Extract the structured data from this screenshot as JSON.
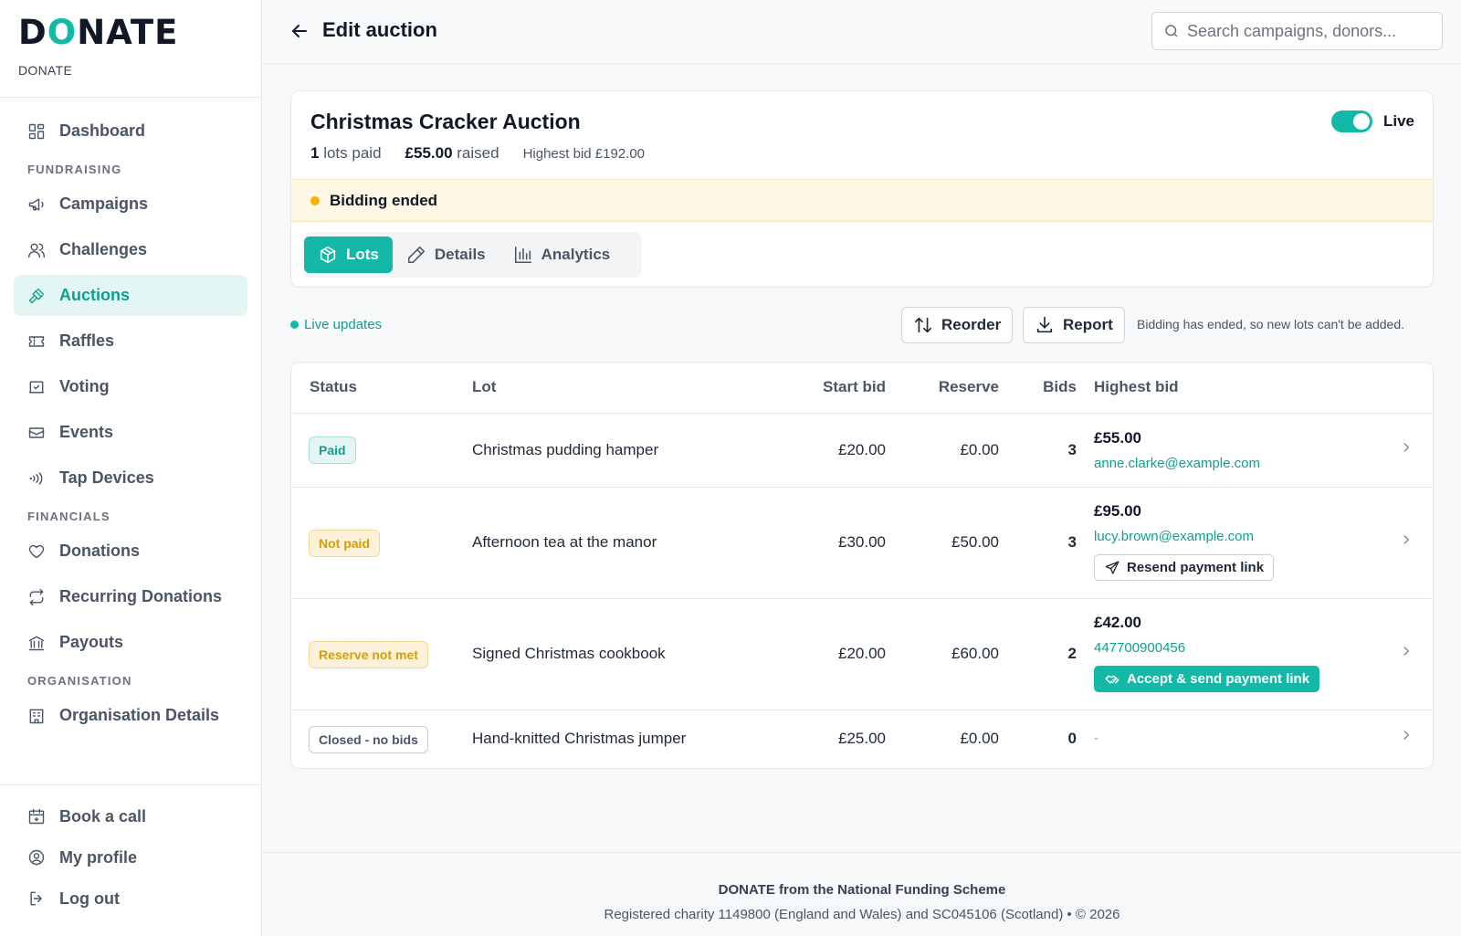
{
  "brand": {
    "logo_text_1": "D",
    "logo_text_o": "O",
    "logo_text_2": "NATE",
    "subtitle": "DONATE"
  },
  "sidebar": {
    "dashboard": "Dashboard",
    "section_fundraising": "FUNDRAISING",
    "campaigns": "Campaigns",
    "challenges": "Challenges",
    "auctions": "Auctions",
    "raffles": "Raffles",
    "voting": "Voting",
    "events": "Events",
    "tap_devices": "Tap Devices",
    "section_financials": "FINANCIALS",
    "donations": "Donations",
    "recurring_donations": "Recurring Donations",
    "payouts": "Payouts",
    "section_organisation": "ORGANISATION",
    "organisation_details": "Organisation Details",
    "book_call": "Book a call",
    "my_profile": "My profile",
    "log_out": "Log out"
  },
  "header": {
    "title": "Edit auction",
    "search_placeholder": "Search campaigns, donors..."
  },
  "auction": {
    "title": "Christmas Cracker Auction",
    "lots_paid_count": "1",
    "lots_paid_label": "lots paid",
    "raised_amount": "£55.00",
    "raised_label": "raised",
    "highest_bid": "Highest bid £192.00",
    "live_label": "Live",
    "live_on": true,
    "banner": "Bidding ended"
  },
  "tabs": {
    "lots": "Lots",
    "details": "Details",
    "analytics": "Analytics"
  },
  "actions": {
    "live_updates": "Live updates",
    "reorder": "Reorder",
    "report": "Report",
    "hint": "Bidding has ended, so new lots can't be added."
  },
  "table": {
    "headers": {
      "status": "Status",
      "lot": "Lot",
      "start_bid": "Start bid",
      "reserve": "Reserve",
      "bids": "Bids",
      "highest_bid": "Highest bid"
    },
    "rows": [
      {
        "status": "Paid",
        "lot": "Christmas pudding hamper",
        "start_bid": "£20.00",
        "reserve": "£0.00",
        "bids": "3",
        "highest_amount": "£55.00",
        "bidder": "anne.clarke@example.com"
      },
      {
        "status": "Not paid",
        "lot": "Afternoon tea at the manor",
        "start_bid": "£30.00",
        "reserve": "£50.00",
        "bids": "3",
        "highest_amount": "£95.00",
        "bidder": "lucy.brown@example.com",
        "action": "Resend payment link"
      },
      {
        "status": "Reserve not met",
        "lot": "Signed Christmas cookbook",
        "start_bid": "£20.00",
        "reserve": "£60.00",
        "bids": "2",
        "highest_amount": "£42.00",
        "bidder": "447700900456",
        "action": "Accept & send payment link"
      },
      {
        "status": "Closed - no bids",
        "lot": "Hand-knitted Christmas jumper",
        "start_bid": "£25.00",
        "reserve": "£0.00",
        "bids": "0",
        "highest_dash": "-"
      }
    ]
  },
  "footer": {
    "line1": "DONATE from the National Funding Scheme",
    "line2": "Registered charity 1149800 (England and Wales) and SC045106 (Scotland)  •  © 2026"
  }
}
